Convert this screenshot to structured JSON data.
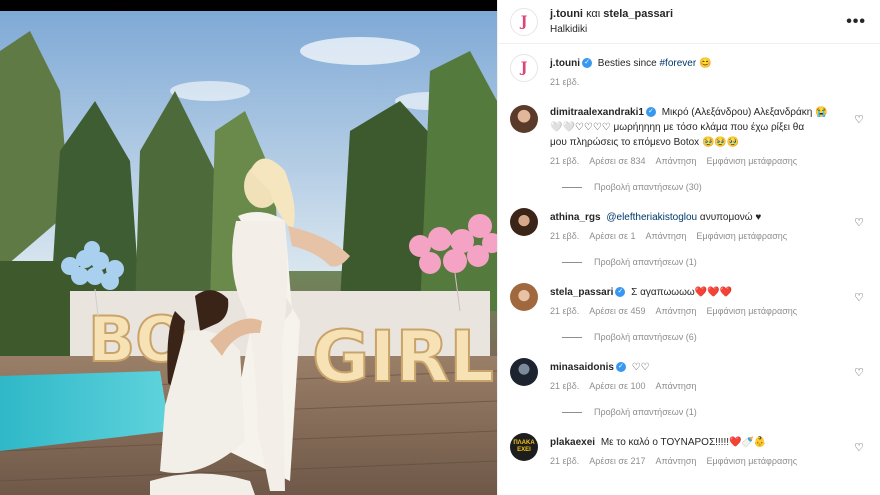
{
  "header": {
    "user1": "j.touni",
    "and": "και",
    "user2": "stela_passari",
    "location": "Halkidiki",
    "avatar_letter": "J"
  },
  "caption": {
    "user": "j.touni",
    "text": "Besties since",
    "hashtag": "#forever",
    "emoji": "😊",
    "time": "21 εβδ."
  },
  "comments": [
    {
      "user": "dimitraalexandraki1",
      "line1": "Μικρό (Αλεξάνδρου) Αλεξανδράκη 😭",
      "line2": "🤍🤍♡♡♡♡ μωρήηηηη με τόσο κλάμα που έχω ρίξει θα",
      "line3": "μου πληρώσεις το επόμενο Botox 🥹🥹🥹",
      "time": "21 εβδ.",
      "likes": "Αρέσει σε 834",
      "reply": "Απάντηση",
      "translate": "Εμφάνιση μετάφρασης",
      "replies": "Προβολή απαντήσεων (30)"
    },
    {
      "user": "athina_rgs",
      "mention": "@eleftheriakistoglou",
      "text": "ανυπομονώ ♥",
      "time": "21 εβδ.",
      "likes": "Αρέσει σε 1",
      "reply": "Απάντηση",
      "translate": "Εμφάνιση μετάφρασης",
      "replies": "Προβολή απαντήσεων (1)"
    },
    {
      "user": "stela_passari",
      "text": "Σ αγαπωωωω",
      "hearts": "❤️❤️❤️",
      "time": "21 εβδ.",
      "likes": "Αρέσει σε 459",
      "reply": "Απάντηση",
      "translate": "Εμφάνιση μετάφρασης",
      "replies": "Προβολή απαντήσεων (6)"
    },
    {
      "user": "minasaidonis",
      "text": "♡♡",
      "time": "21 εβδ.",
      "likes": "Αρέσει σε 100",
      "reply": "Απάντηση",
      "replies": "Προβολή απαντήσεων (1)"
    },
    {
      "user": "plakaexei",
      "text": "Με το καλό ο ΤΟΥΝΑΡΟΣ!!!!!",
      "emojis": "❤️🍼👶",
      "avatar_text": "ΠΛΑΚΑ ΕΧΕΙ",
      "time": "21 εβδ.",
      "likes": "Αρέσει σε 217",
      "reply": "Απάντηση",
      "translate": "Εμφάνιση μετάφρασης"
    }
  ],
  "photo": {
    "sign_left": "BO",
    "sign_right": "GIRL"
  },
  "icons": {
    "more": "more-options-icon",
    "like": "heart-outline-icon",
    "verified": "verified-badge-icon"
  },
  "colors": {
    "link": "#00376b",
    "verified": "#3897f0",
    "muted": "#8e8e8e"
  }
}
